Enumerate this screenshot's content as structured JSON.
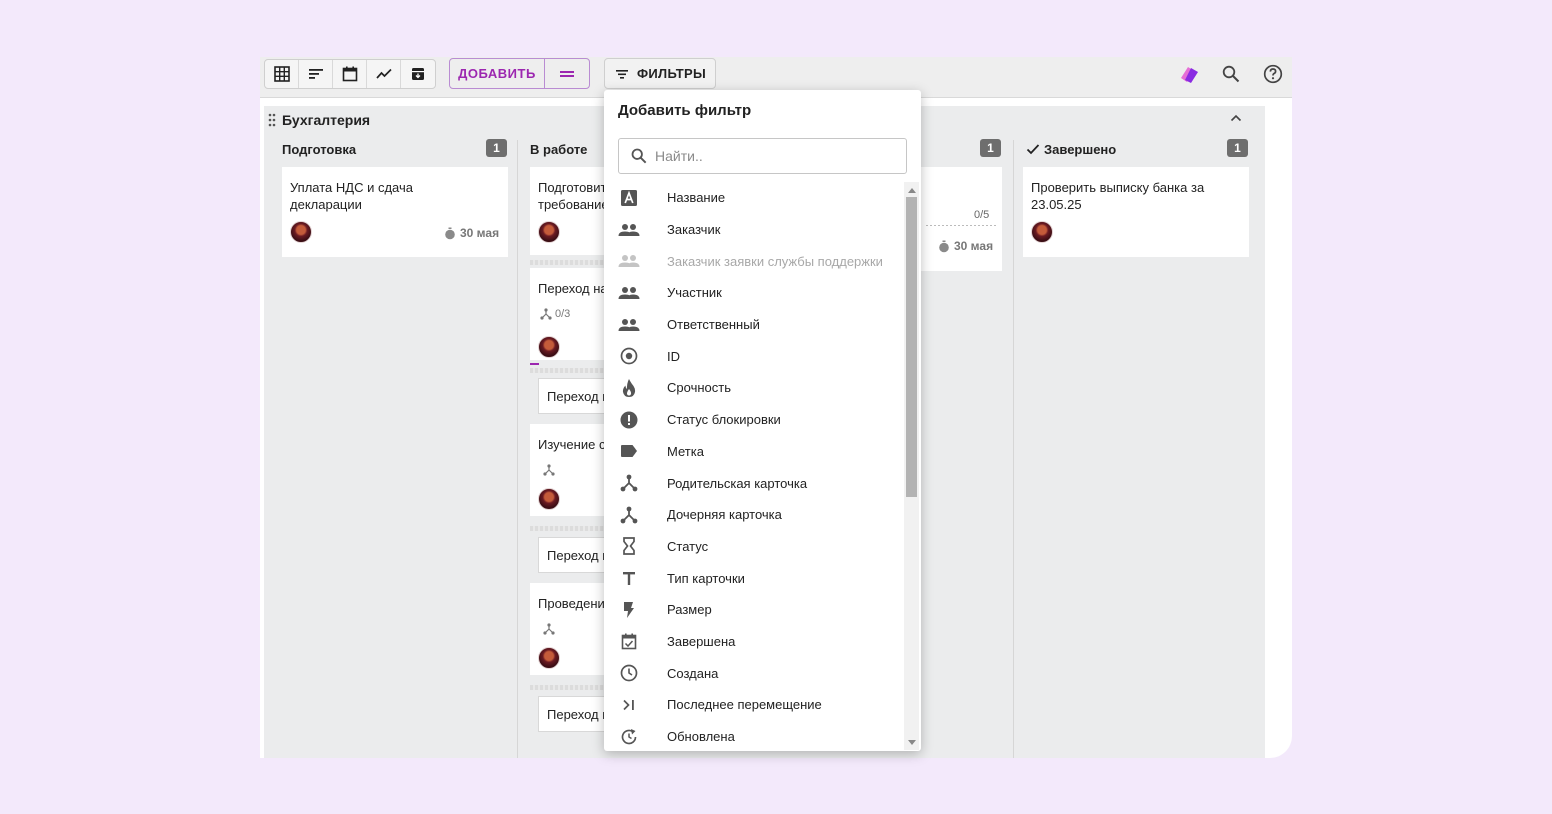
{
  "toolbar": {
    "add_label": "ДОБАВИТЬ",
    "filters_label": "ФИЛЬТРЫ",
    "view_icons": [
      "table-icon",
      "list-icon",
      "calendar-icon",
      "chart-icon",
      "archive-icon"
    ],
    "accent_color": "#9c27b0"
  },
  "swimlane": {
    "title": "Бухгалтерия"
  },
  "columns": [
    {
      "name": "Подготовка",
      "count": "1"
    },
    {
      "name": "В работе",
      "count": ""
    },
    {
      "name": "",
      "count": "1"
    },
    {
      "name": "Завершено",
      "count": "1"
    }
  ],
  "cards": {
    "prep": {
      "title_line1": "Уплата НДС и сдача",
      "title_line2": "декларации",
      "due": "30 мая"
    },
    "work": [
      {
        "title_line1": "Подготовит",
        "title_line2": "требование"
      },
      {
        "title": "Переход на",
        "sub": "0/3"
      },
      {
        "title": "Переход н"
      },
      {
        "title": "Изучение с"
      },
      {
        "title": "Переход н"
      },
      {
        "title": "Проведение"
      },
      {
        "title": "Переход н"
      }
    ],
    "third": {
      "checklist": "0/5",
      "due": "30 мая"
    },
    "done": {
      "title_line1": "Проверить выписку банка за",
      "title_line2": "23.05.25"
    }
  },
  "filter_dropdown": {
    "title": "Добавить фильтр",
    "search_placeholder": "Найти..",
    "items": [
      {
        "label": "Название",
        "icon": "text-box-icon",
        "disabled": false
      },
      {
        "label": "Заказчик",
        "icon": "people-icon",
        "disabled": false
      },
      {
        "label": "Заказчик заявки службы поддержки",
        "icon": "people-icon",
        "disabled": true
      },
      {
        "label": "Участник",
        "icon": "people-icon",
        "disabled": false
      },
      {
        "label": "Ответственный",
        "icon": "people-icon",
        "disabled": false
      },
      {
        "label": "ID",
        "icon": "target-icon",
        "disabled": false
      },
      {
        "label": "Срочность",
        "icon": "fire-icon",
        "disabled": false
      },
      {
        "label": "Статус блокировки",
        "icon": "alert-icon",
        "disabled": false
      },
      {
        "label": "Метка",
        "icon": "label-icon",
        "disabled": false
      },
      {
        "label": "Родительская карточка",
        "icon": "hierarchy-icon",
        "disabled": false
      },
      {
        "label": "Дочерняя карточка",
        "icon": "hierarchy-icon",
        "disabled": false
      },
      {
        "label": "Статус",
        "icon": "hourglass-icon",
        "disabled": false
      },
      {
        "label": "Тип карточки",
        "icon": "type-icon",
        "disabled": false
      },
      {
        "label": "Размер",
        "icon": "bolt-icon",
        "disabled": false
      },
      {
        "label": "Завершена",
        "icon": "calendar-check-icon",
        "disabled": false
      },
      {
        "label": "Создана",
        "icon": "clock-icon",
        "disabled": false
      },
      {
        "label": "Последнее перемещение",
        "icon": "move-icon",
        "disabled": false
      },
      {
        "label": "Обновлена",
        "icon": "refresh-icon",
        "disabled": false
      }
    ]
  }
}
